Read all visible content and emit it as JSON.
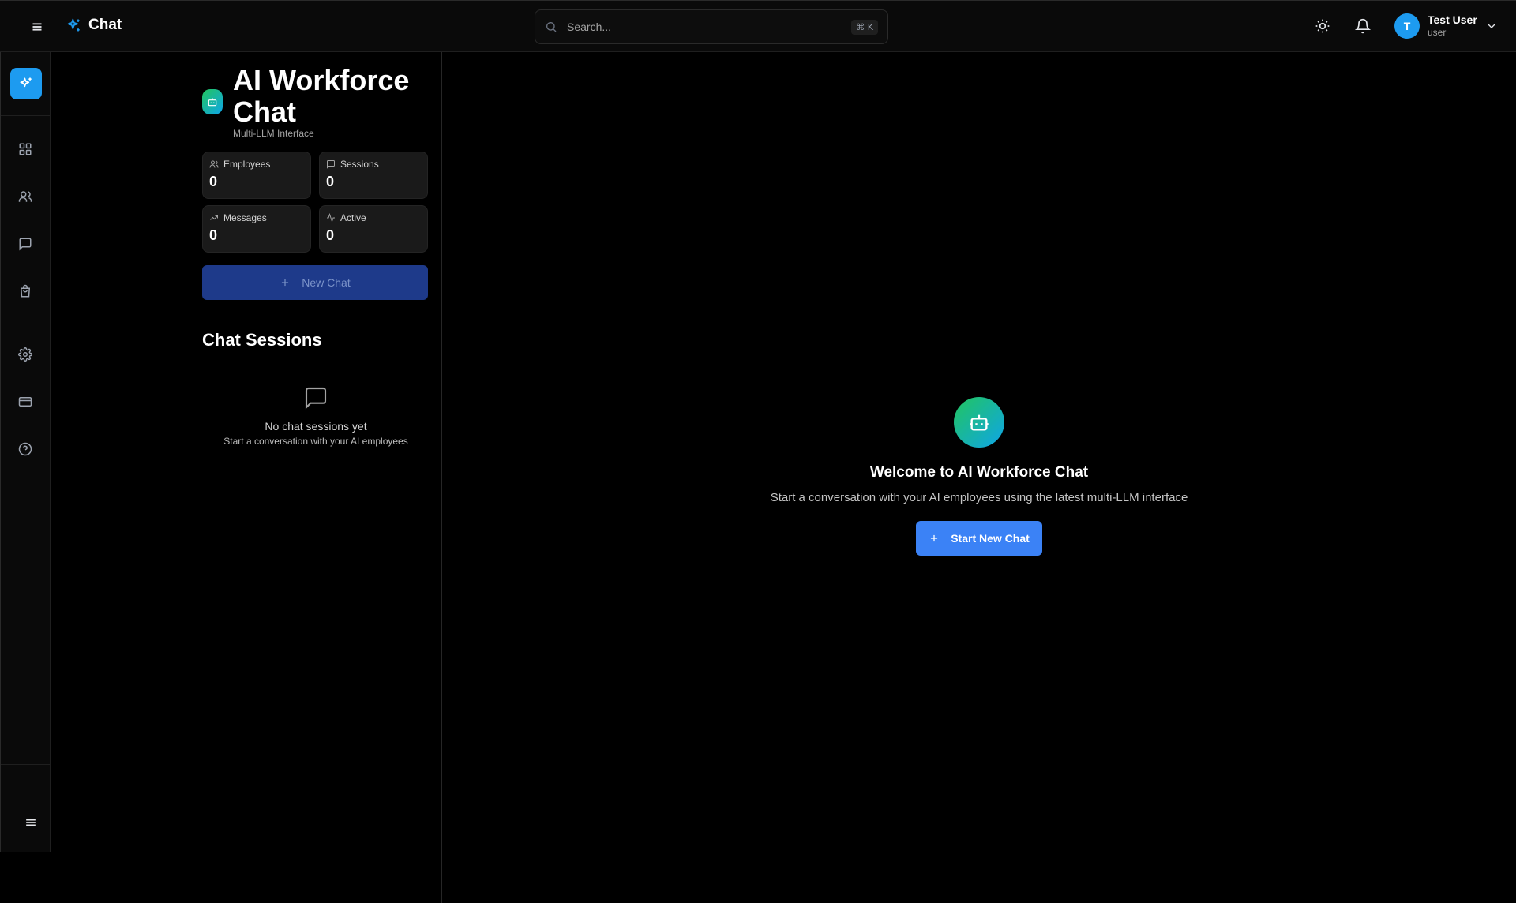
{
  "header": {
    "brand": "Chat",
    "search": {
      "placeholder": "Search...",
      "shortcut": "⌘ K"
    },
    "user": {
      "initial": "T",
      "name": "Test User",
      "role": "user"
    }
  },
  "rail": {
    "items": [
      "chat-sparkle-icon",
      "dashboard-icon",
      "users-icon",
      "message-icon",
      "shopping-bag-icon",
      "settings-icon",
      "credit-card-icon",
      "help-icon"
    ]
  },
  "panel": {
    "title": "AI Workforce Chat",
    "subtitle": "Multi-LLM Interface",
    "stats": [
      {
        "label": "Employees",
        "value": "0",
        "icon": "users-icon"
      },
      {
        "label": "Sessions",
        "value": "0",
        "icon": "message-icon"
      },
      {
        "label": "Messages",
        "value": "0",
        "icon": "trending-up-icon"
      },
      {
        "label": "Active",
        "value": "0",
        "icon": "activity-icon"
      }
    ],
    "new_chat_label": "New Chat",
    "sessions_title": "Chat Sessions",
    "empty_title": "No chat sessions yet",
    "empty_sub": "Start a conversation with your AI employees"
  },
  "main": {
    "welcome_title": "Welcome to AI Workforce Chat",
    "welcome_sub": "Start a conversation with your AI employees using the latest multi-LLM interface",
    "start_label": "Start New Chat"
  },
  "colors": {
    "accent": "#1d9bf0",
    "primary_button": "#3b82f6",
    "disabled_button": "#1e3a8a"
  }
}
